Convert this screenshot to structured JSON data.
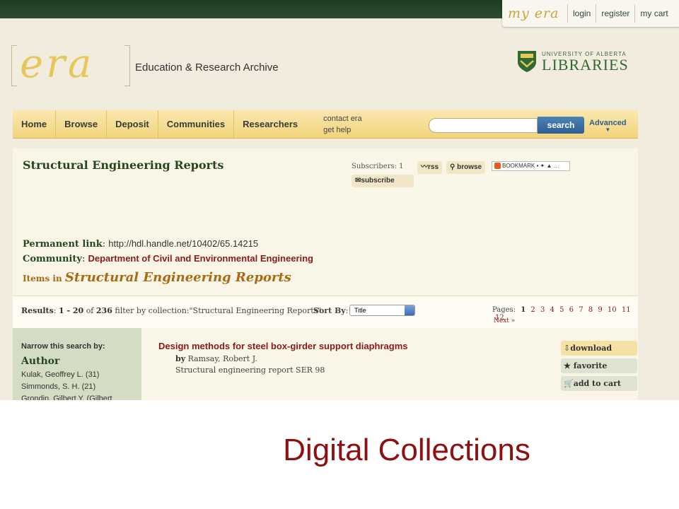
{
  "account": {
    "brand": "my era",
    "login": "login",
    "register": "register",
    "cart": "my cart"
  },
  "header": {
    "logo_text": "era",
    "tagline": "Education & Research Archive",
    "ua_small": "UNIVERSITY OF ALBERTA",
    "ua_big": "LIBRARIES"
  },
  "nav": {
    "items": [
      "Home",
      "Browse",
      "Deposit",
      "Communities",
      "Researchers"
    ],
    "contact": "contact era",
    "help": "get help",
    "search_placeholder": "",
    "search_button": "search",
    "advanced": "Advanced"
  },
  "collection": {
    "title": "Structural Engineering Reports",
    "subscribers_label": "Subscribers: 1",
    "rss": "rss",
    "browse": "browse",
    "subscribe": "subscribe",
    "bookmark": "BOOKMARK",
    "permanent_link_label": "Permanent link",
    "permanent_link": "http://hdl.handle.net/10402/65.14215",
    "community_label": "Community",
    "community": "Department of Civil and Environmental Engineering",
    "items_in_label": "Items in",
    "items_in_name": "Structural Engineering Reports"
  },
  "results": {
    "label": "Results",
    "range": "1 - 20",
    "of_text": "of",
    "total": "236",
    "filter_text": "filter by collection:\"Structural Engineering Reports\"",
    "sort_label": "Sort By",
    "sort_value": "Title",
    "pages_label": "Pages:",
    "pages": [
      "1",
      "2",
      "3",
      "4",
      "5",
      "6",
      "7",
      "8",
      "9",
      "10",
      "11",
      "12"
    ],
    "next": "Next »"
  },
  "sidebar": {
    "narrow": "Narrow this search by:",
    "facet_heading": "Author",
    "facets": [
      "Kulak, Geoffrey L. (31)",
      "Simmonds, S. H. (21)",
      "Grondin, Gilbert Y. (Gilbert"
    ]
  },
  "item": {
    "title": "Design methods for steel box-girder support diaphragms",
    "by_label": "by",
    "author": "Ramsay, Robert J.",
    "series": "Structural engineering report SER 98",
    "download": "download",
    "favorite": "favorite",
    "add_to_cart": "add to cart"
  },
  "caption": "Digital Collections"
}
